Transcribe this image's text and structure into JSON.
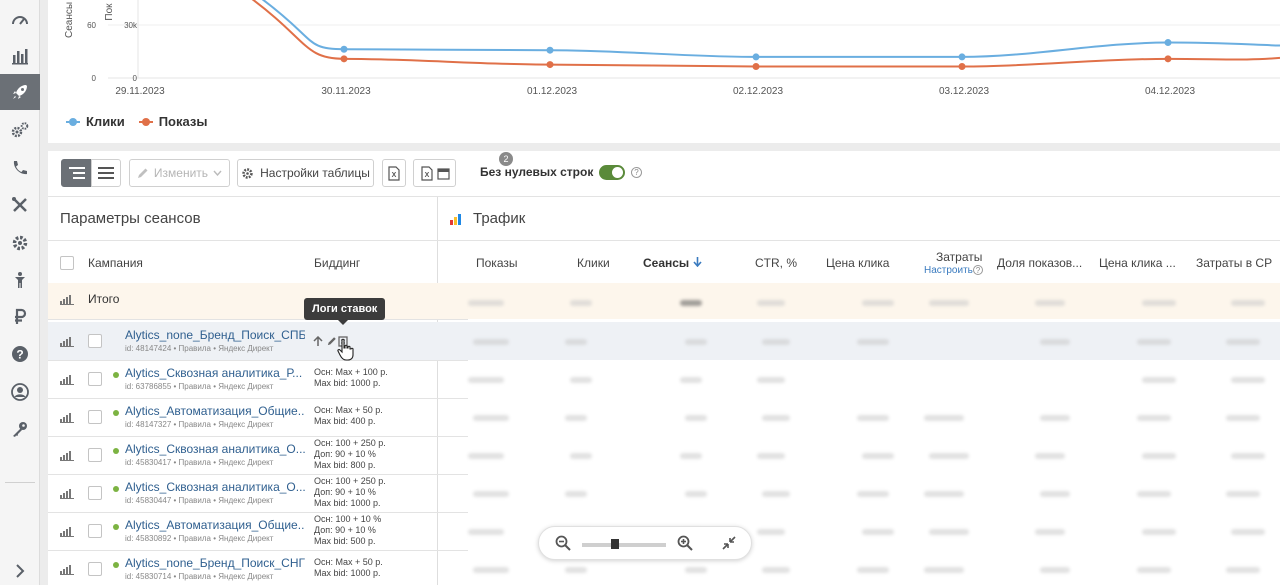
{
  "sidebar": {
    "icons": [
      "speedometer-icon",
      "bar-chart-icon",
      "rocket-icon",
      "settings-gears-icon",
      "phone-icon",
      "tools-icon",
      "gear-icon",
      "user-figure-icon",
      "ruble-icon",
      "help-icon",
      "account-icon",
      "key-icon",
      "chevron-right-icon"
    ],
    "active_index": 2
  },
  "chart": {
    "y_axis_left_label": "Сеансы",
    "y_axis_right_label": "Пок",
    "y_ticks_left": [
      "60",
      "0"
    ],
    "y_ticks_right": [
      "30k",
      "0"
    ],
    "legend": [
      {
        "label": "Клики",
        "color": "#6aaee0"
      },
      {
        "label": "Показы",
        "color": "#e07048"
      }
    ]
  },
  "chart_data": {
    "type": "line",
    "x": [
      "29.11.2023",
      "30.11.2023",
      "01.12.2023",
      "02.12.2023",
      "03.12.2023",
      "04.12.2023"
    ],
    "series": [
      {
        "name": "Клики",
        "values": [
          null,
          30,
          29,
          22,
          22,
          37
        ]
      },
      {
        "name": "Показы",
        "values": [
          null,
          20,
          14,
          12,
          12,
          20
        ]
      }
    ],
    "ylim": [
      0,
      120
    ],
    "grid": true,
    "legend_position": "bottom-left"
  },
  "toolbar": {
    "edit_label": "Изменить",
    "settings_label": "Настройки таблицы",
    "badge_count": "2",
    "toggle_label": "Без нулевых строк",
    "toggle_on": true
  },
  "table": {
    "section_left": "Параметры сеансов",
    "section_right": "Трафик",
    "headers": {
      "campaign": "Кампания",
      "bidding": "Биддинг",
      "impressions": "Показы",
      "clicks": "Клики",
      "sessions": "Сеансы",
      "ctr": "CTR, %",
      "cpc": "Цена клика",
      "cost": "Затраты",
      "cost_sub": "Настроить",
      "share": "Доля показов...",
      "cpc2": "Цена клика ...",
      "cost_cp": "Затраты в СР"
    },
    "total_label": "Итого",
    "rows": [
      {
        "name": "Alytics_none_Бренд_Поиск_СПБ",
        "meta": "id: 48147424 • Правила • Яндекс Директ",
        "bid": []
      },
      {
        "name": "Alytics_Сквозная аналитика_Р...",
        "meta": "id: 63786855 • Правила • Яндекс Директ",
        "bid": [
          "Осн: Max + 100 р.",
          "Max bid: 1000 р."
        ]
      },
      {
        "name": "Alytics_Автоматизация_Общие...",
        "meta": "id: 48147327 • Правила • Яндекс Директ",
        "bid": [
          "Осн: Max + 50 р.",
          "Max bid: 400 р."
        ]
      },
      {
        "name": "Alytics_Сквозная аналитика_О...",
        "meta": "id: 45830417 • Правила • Яндекс Директ",
        "bid": [
          "Осн: 100 + 250 р.",
          "Доп: 90 + 10 %",
          "Max bid: 800 р."
        ]
      },
      {
        "name": "Alytics_Сквозная аналитика_О...",
        "meta": "id: 45830447 • Правила • Яндекс Директ",
        "bid": [
          "Осн: 100 + 250 р.",
          "Доп: 90 + 10 %",
          "Max bid: 1000 р."
        ]
      },
      {
        "name": "Alytics_Автоматизация_Общие...",
        "meta": "id: 45830892 • Правила • Яндекс Директ",
        "bid": [
          "Осн: 100 + 10 %",
          "Доп: 90 + 10 %",
          "Max bid: 500 р."
        ]
      },
      {
        "name": "Alytics_none_Бренд_Поиск_СНГ",
        "meta": "id: 45830714 • Правила • Яндекс Директ",
        "bid": [
          "Осн: Max + 50 р.",
          "Max bid: 1000 р."
        ]
      }
    ]
  },
  "tooltip": {
    "text": "Логи ставок"
  }
}
